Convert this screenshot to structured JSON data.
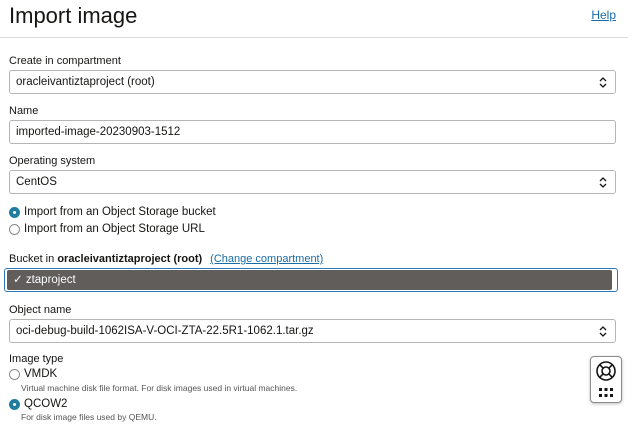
{
  "header": {
    "title": "Import image",
    "help_label": "Help"
  },
  "compartment": {
    "label": "Create in compartment",
    "value": "oracleivantiztaproject (root)"
  },
  "name": {
    "label": "Name",
    "value": "imported-image-20230903-1512"
  },
  "os": {
    "label": "Operating system",
    "value": "CentOS"
  },
  "source": {
    "options": [
      {
        "label": "Import from an Object Storage bucket",
        "selected": true
      },
      {
        "label": "Import from an Object Storage URL",
        "selected": false
      }
    ]
  },
  "bucket": {
    "label_prefix": "Bucket in ",
    "compartment": "oracleivantiztaproject (root)",
    "change_label": "(Change compartment)",
    "selected_option": "✓ ztaproject"
  },
  "object": {
    "label": "Object name",
    "value": "oci-debug-build-1062ISA-V-OCI-ZTA-22.5R1-1062.1.tar.gz"
  },
  "image_type": {
    "label": "Image type",
    "options": [
      {
        "label": "VMDK",
        "hint": "Virtual machine disk file format. For disk images used in virtual machines.",
        "selected": false
      },
      {
        "label": "QCOW2",
        "hint": "For disk image files used by QEMU.",
        "selected": true
      }
    ]
  },
  "icons": {
    "select": "updown-chevron-icon",
    "help_widget": "lifebuoy-icon",
    "apps": "grid-dots-icon"
  },
  "colors": {
    "accent": "#227e9e",
    "link": "#1a6ca8",
    "focus": "#2d78b7",
    "highlight": "#605d5b"
  }
}
